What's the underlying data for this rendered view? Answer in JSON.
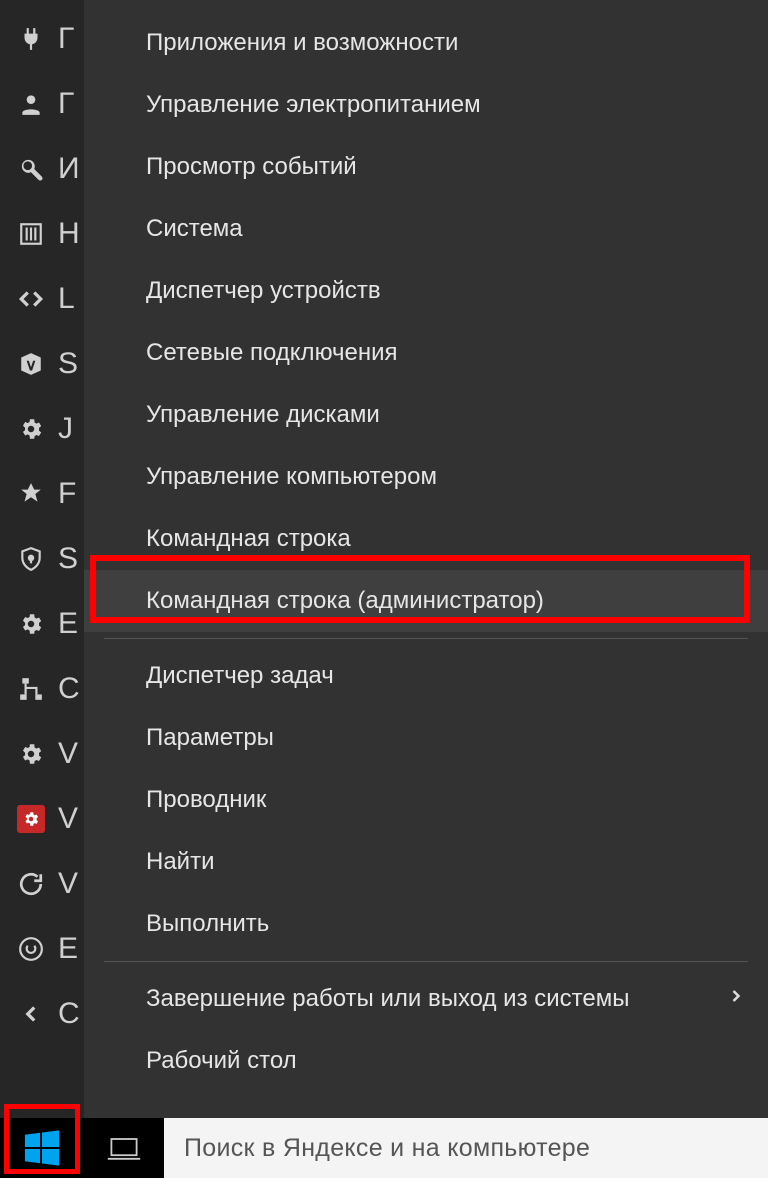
{
  "sidebar": {
    "items": [
      {
        "label": "Г",
        "icon": "plug"
      },
      {
        "label": "Г",
        "icon": "user"
      },
      {
        "label": "И",
        "icon": "wrench"
      },
      {
        "label": "Н",
        "icon": "sliders"
      },
      {
        "label": "L",
        "icon": "code"
      },
      {
        "label": "S",
        "icon": "yoast"
      },
      {
        "label": "J",
        "icon": "gear"
      },
      {
        "label": "F",
        "icon": "rank"
      },
      {
        "label": "S",
        "icon": "shield"
      },
      {
        "label": "E",
        "icon": "gear"
      },
      {
        "label": "C",
        "icon": "network"
      },
      {
        "label": "V",
        "icon": "gear"
      },
      {
        "label": "V",
        "icon": "gear-red"
      },
      {
        "label": "V",
        "icon": "sync"
      },
      {
        "label": "E",
        "icon": "circle-arrow"
      },
      {
        "label": "С",
        "icon": "chevron-left"
      }
    ]
  },
  "menu": {
    "groups": [
      {
        "items": [
          {
            "label": "Приложения и возможности",
            "key": "apps-features"
          },
          {
            "label": "Управление электропитанием",
            "key": "power-options"
          },
          {
            "label": "Просмотр событий",
            "key": "event-viewer"
          },
          {
            "label": "Система",
            "key": "system"
          },
          {
            "label": "Диспетчер устройств",
            "key": "device-manager"
          },
          {
            "label": "Сетевые подключения",
            "key": "network-connections"
          },
          {
            "label": "Управление дисками",
            "key": "disk-management"
          },
          {
            "label": "Управление компьютером",
            "key": "computer-management"
          },
          {
            "label": "Командная строка",
            "key": "command-prompt"
          },
          {
            "label": "Командная строка (администратор)",
            "key": "command-prompt-admin",
            "hover": true
          }
        ]
      },
      {
        "items": [
          {
            "label": "Диспетчер задач",
            "key": "task-manager"
          },
          {
            "label": "Параметры",
            "key": "settings"
          },
          {
            "label": "Проводник",
            "key": "explorer"
          },
          {
            "label": "Найти",
            "key": "search"
          },
          {
            "label": "Выполнить",
            "key": "run"
          }
        ]
      },
      {
        "items": [
          {
            "label": "Завершение работы или выход из системы",
            "key": "shutdown-signout",
            "submenu": true
          },
          {
            "label": "Рабочий стол",
            "key": "desktop"
          }
        ]
      }
    ]
  },
  "taskbar": {
    "search_placeholder": "Поиск в Яндексе и на компьютере"
  }
}
